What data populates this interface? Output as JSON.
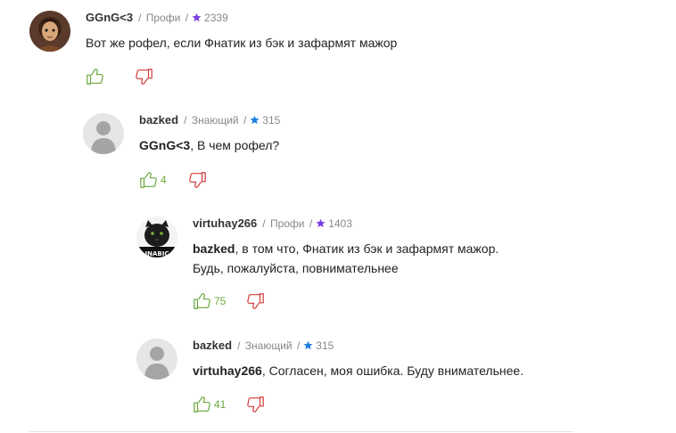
{
  "colors": {
    "star_profi": "#7a3fe0",
    "star_znayushchiy": "#1d7fe0",
    "like": "#6aa83a",
    "dislike": "#d23a3a"
  },
  "comments": [
    {
      "author": "GGnG<3",
      "rank": "Профи",
      "sep1": "/",
      "sep2": "/",
      "rating": "2339",
      "reply_to": "",
      "text": "Вот же рофел, если Фнатик из бэк и зафармят мажор",
      "text2": "",
      "likes": "",
      "avatar": "anime-character-avatar"
    },
    {
      "author": "bazked",
      "rank": "Знающий",
      "sep1": "/",
      "sep2": "/",
      "rating": "315",
      "reply_to": "GGnG<3",
      "text": ", В чем рофел?",
      "text2": "",
      "likes": "4",
      "avatar": "default-user-avatar"
    },
    {
      "author": "virtuhay266",
      "rank": "Профи",
      "sep1": "/",
      "sep2": "/",
      "rating": "1403",
      "reply_to": "bazked",
      "text": ", в том что, Фнатик из бэк и зафармят мажор.",
      "text2": "Будь, пожалуйста, повнимательнее",
      "likes": "75",
      "avatar": "black-panther-avatar"
    },
    {
      "author": "bazked",
      "rank": "Знающий",
      "sep1": "/",
      "sep2": "/",
      "rating": "315",
      "reply_to": "virtuhay266",
      "text": ", Согласен, моя ошибка. Буду внимательнее.",
      "text2": "",
      "likes": "41",
      "avatar": "default-user-avatar"
    }
  ]
}
